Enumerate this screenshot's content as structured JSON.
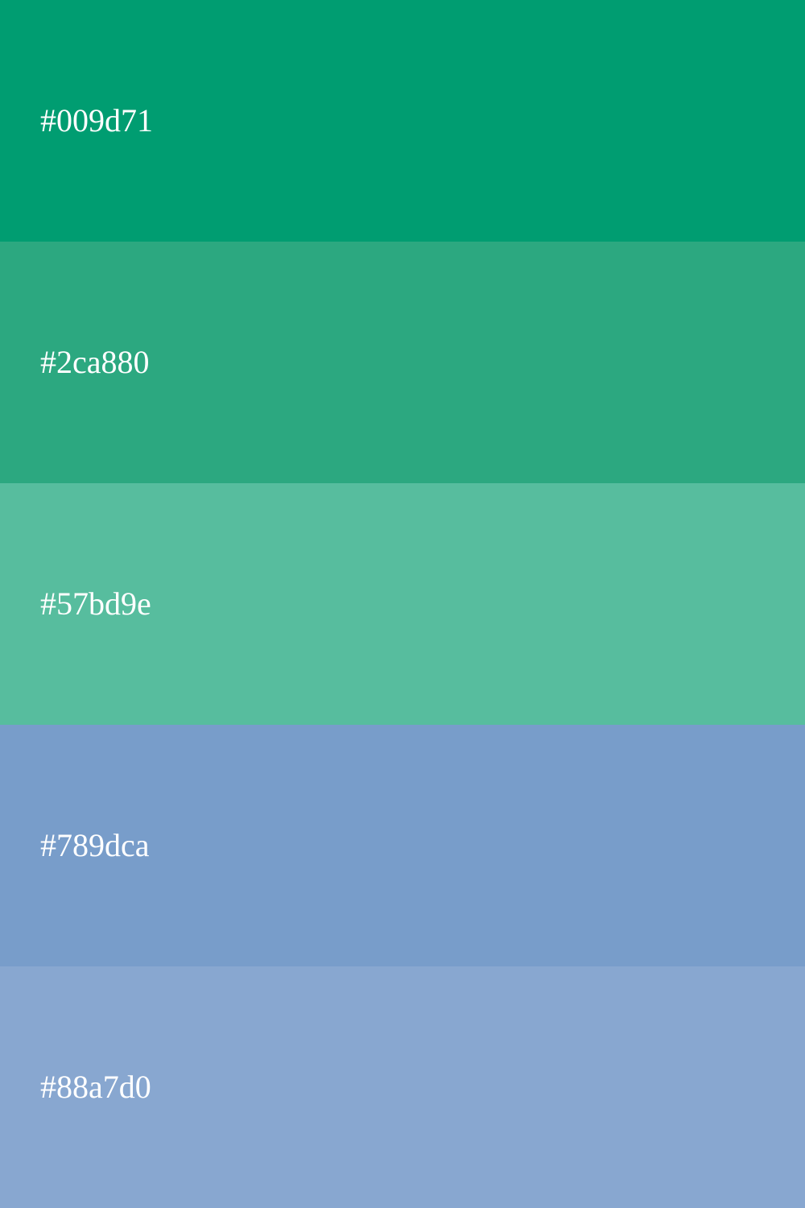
{
  "swatches": [
    {
      "label": "#009d71",
      "color": "#009d71"
    },
    {
      "label": "#2ca880",
      "color": "#2ca880"
    },
    {
      "label": "#57bd9e",
      "color": "#57bd9e"
    },
    {
      "label": "#789dca",
      "color": "#789dca"
    },
    {
      "label": "#88a7d0",
      "color": "#88a7d0"
    }
  ]
}
